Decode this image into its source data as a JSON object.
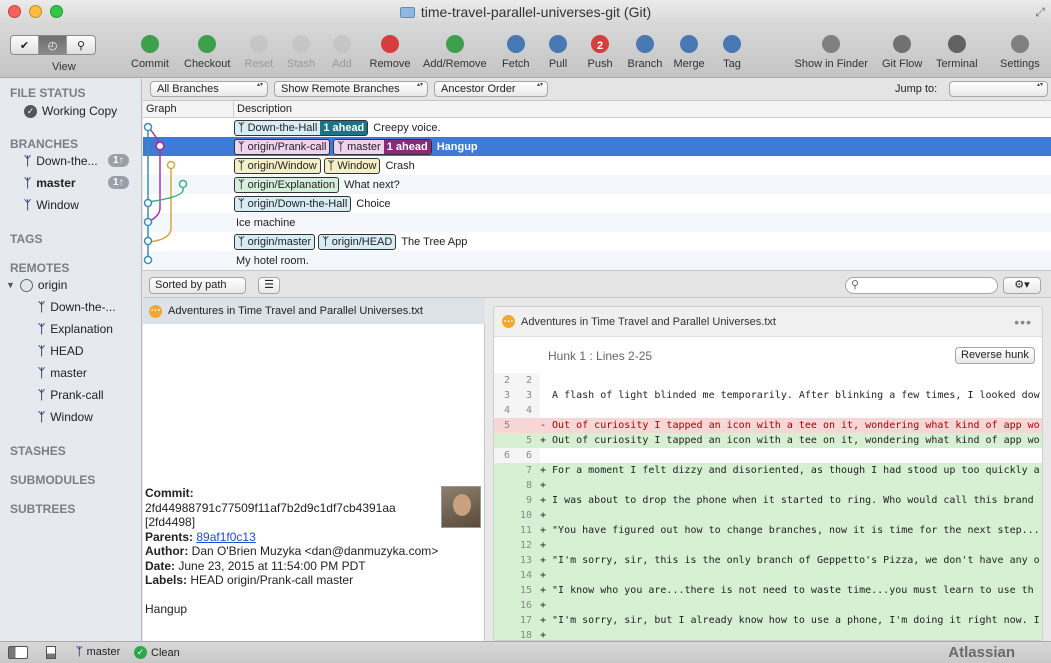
{
  "window": {
    "title": "time-travel-parallel-universes-git (Git)"
  },
  "toolbar": {
    "view_label": "View",
    "buttons": [
      {
        "label": "Commit",
        "icon": "commit-icon",
        "enabled": true
      },
      {
        "label": "Checkout",
        "icon": "checkout-icon",
        "enabled": true
      },
      {
        "label": "Reset",
        "icon": "reset-icon",
        "enabled": false
      },
      {
        "label": "Stash",
        "icon": "stash-icon",
        "enabled": false
      },
      {
        "label": "Add",
        "icon": "add-icon",
        "enabled": false
      },
      {
        "label": "Remove",
        "icon": "remove-icon",
        "enabled": true
      },
      {
        "label": "Add/Remove",
        "icon": "add-remove-icon",
        "enabled": true
      },
      {
        "label": "Fetch",
        "icon": "fetch-icon",
        "enabled": true
      },
      {
        "label": "Pull",
        "icon": "pull-icon",
        "enabled": true
      },
      {
        "label": "Push",
        "icon": "push-icon",
        "enabled": true,
        "badge": "2"
      },
      {
        "label": "Branch",
        "icon": "branch-icon",
        "enabled": true
      },
      {
        "label": "Merge",
        "icon": "merge-icon",
        "enabled": true
      },
      {
        "label": "Tag",
        "icon": "tag-icon",
        "enabled": true
      },
      {
        "label": "Show in Finder",
        "icon": "finder-icon",
        "enabled": true
      },
      {
        "label": "Git Flow",
        "icon": "gitflow-icon",
        "enabled": true
      },
      {
        "label": "Terminal",
        "icon": "terminal-icon",
        "enabled": true
      },
      {
        "label": "Settings",
        "icon": "settings-icon",
        "enabled": true
      }
    ]
  },
  "sidebar": {
    "file_status": "FILE STATUS",
    "working_copy": "Working Copy",
    "branches_title": "BRANCHES",
    "branches": [
      {
        "label": "Down-the...",
        "badge": "1↑",
        "current": false
      },
      {
        "label": "master",
        "badge": "1↑",
        "current": true
      },
      {
        "label": "Window",
        "badge": "",
        "current": false
      }
    ],
    "tags_title": "TAGS",
    "remotes_title": "REMOTES",
    "remote_name": "origin",
    "remote_branches": [
      "Down-the-...",
      "Explanation",
      "HEAD",
      "master",
      "Prank-call",
      "Window"
    ],
    "stashes_title": "STASHES",
    "submodules_title": "SUBMODULES",
    "subtrees_title": "SUBTREES"
  },
  "filters": {
    "branches": "All Branches",
    "remote": "Show Remote Branches",
    "order": "Ancestor Order",
    "jump_label": "Jump to:"
  },
  "columns": {
    "graph": "Graph",
    "description": "Description"
  },
  "commits": [
    {
      "tags": [
        {
          "name": "Down-the-Hall",
          "style": "t-blue",
          "ahead": "1 ahead"
        }
      ],
      "message": "Creepy voice."
    },
    {
      "tags": [
        {
          "name": "origin/Prank-call",
          "style": "t-pink",
          "ahead": ""
        },
        {
          "name": "master",
          "style": "t-pink",
          "ahead": "1 ahead",
          "ahead_color": "#8a2a7a"
        }
      ],
      "message": "Hangup",
      "selected": true
    },
    {
      "tags": [
        {
          "name": "origin/Window",
          "style": "t-yellow",
          "ahead": ""
        },
        {
          "name": "Window",
          "style": "t-yellow",
          "ahead": ""
        }
      ],
      "message": "Crash"
    },
    {
      "tags": [
        {
          "name": "origin/Explanation",
          "style": "t-green",
          "ahead": ""
        }
      ],
      "message": "What next?"
    },
    {
      "tags": [
        {
          "name": "origin/Down-the-Hall",
          "style": "t-blue",
          "ahead": ""
        }
      ],
      "message": "Choice"
    },
    {
      "tags": [],
      "message": "Ice machine"
    },
    {
      "tags": [
        {
          "name": "origin/master",
          "style": "t-blue",
          "ahead": ""
        },
        {
          "name": "origin/HEAD",
          "style": "t-blue",
          "ahead": ""
        }
      ],
      "message": "The Tree App"
    },
    {
      "tags": [],
      "message": "My hotel room."
    }
  ],
  "lower": {
    "sort_label": "Sorted by path"
  },
  "files": [
    {
      "name": "Adventures in Time Travel and Parallel Universes.txt",
      "status_icon": "modified-icon"
    }
  ],
  "commit_info": {
    "commit_label": "Commit:",
    "hash": "2fd44988791c77509f11af7b2d9c1df7cb4391aa",
    "short": "[2fd4498]",
    "parents_label": "Parents:",
    "parents": "89af1f0c13",
    "author_label": "Author:",
    "author": "Dan O'Brien Muzyka <dan@danmuzyka.com>",
    "date_label": "Date:",
    "date": "June 23, 2015 at 11:54:00 PM PDT",
    "labels_label": "Labels:",
    "labels": "HEAD origin/Prank-call master",
    "message": "Hangup"
  },
  "diff": {
    "file": "Adventures in Time Travel and Parallel Universes.txt",
    "hunk_label": "Hunk 1 : Lines 2-25",
    "reverse_label": "Reverse hunk",
    "lines": [
      {
        "o": "2",
        "n": "2",
        "t": "",
        "k": "ctx"
      },
      {
        "o": "3",
        "n": "3",
        "t": "  A flash of light blinded me temporarily. After blinking a few times, I looked dow",
        "k": "ctx"
      },
      {
        "o": "4",
        "n": "4",
        "t": "",
        "k": "ctx"
      },
      {
        "o": "5",
        "n": "",
        "t": "- Out of curiosity I tapped an icon with a tee on it, wondering what kind of app wo",
        "k": "del"
      },
      {
        "o": "",
        "n": "5",
        "t": "+ Out of curiosity I tapped an icon with a tee on it, wondering what kind of app wo",
        "k": "add"
      },
      {
        "o": "6",
        "n": "6",
        "t": "",
        "k": "ctx"
      },
      {
        "o": "",
        "n": "7",
        "t": "+ For a moment I felt dizzy and disoriented, as though I had stood up too quickly a",
        "k": "add"
      },
      {
        "o": "",
        "n": "8",
        "t": "+",
        "k": "add"
      },
      {
        "o": "",
        "n": "9",
        "t": "+ I was about to drop the phone when it started to ring. Who would call this brand",
        "k": "add"
      },
      {
        "o": "",
        "n": "10",
        "t": "+",
        "k": "add"
      },
      {
        "o": "",
        "n": "11",
        "t": "+ \"You have figured out how to change branches, now it is time for the next step...",
        "k": "add"
      },
      {
        "o": "",
        "n": "12",
        "t": "+",
        "k": "add"
      },
      {
        "o": "",
        "n": "13",
        "t": "+ \"I'm sorry, sir, this is the only branch of Geppetto's Pizza, we don't have any o",
        "k": "add"
      },
      {
        "o": "",
        "n": "14",
        "t": "+",
        "k": "add"
      },
      {
        "o": "",
        "n": "15",
        "t": "+ \"I know who you are...there is not need to waste time...you must learn to use th",
        "k": "add"
      },
      {
        "o": "",
        "n": "16",
        "t": "+",
        "k": "add"
      },
      {
        "o": "",
        "n": "17",
        "t": "+ \"I'm sorry, sir, but I already know how to use a phone, I'm doing it right now. I",
        "k": "add"
      },
      {
        "o": "",
        "n": "18",
        "t": "+",
        "k": "add"
      }
    ]
  },
  "status": {
    "branch": "master",
    "state": "Clean",
    "brand": "Atlassian"
  }
}
